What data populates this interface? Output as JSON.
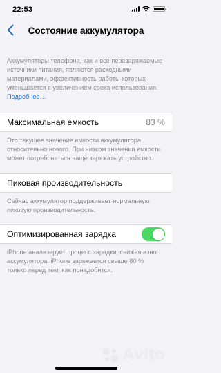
{
  "status_bar": {
    "time": "22:53"
  },
  "nav": {
    "title": "Состояние аккумулятора"
  },
  "intro": {
    "text": "Аккумуляторы телефона, как и все перезаряжаемые источники питания, являются расходными материалами, эффективность работы которых уменьшается с увеличением срока использования.",
    "link": "Подробнее…"
  },
  "max_capacity": {
    "label": "Максимальная емкость",
    "value": "83 %",
    "footer": "Это текущее значение емкости аккумулятора относительно нового. При низком значении емкости может потребоваться чаще заряжать устройство."
  },
  "peak_performance": {
    "label": "Пиковая производительность",
    "footer": "Сейчас аккумулятор поддерживает нормальную пиковую производительность."
  },
  "optimized_charging": {
    "label": "Оптимизированная зарядка",
    "enabled": true,
    "footer": "iPhone анализирует процесс зарядки, снижая износ аккумулятора. iPhone заряжается свыше 80 % только перед тем, как понадобится."
  },
  "watermark": {
    "text": "Avito"
  },
  "colors": {
    "accent": "#2a6fd6",
    "toggle_on": "#4cd964",
    "background": "#f2f2f7"
  }
}
